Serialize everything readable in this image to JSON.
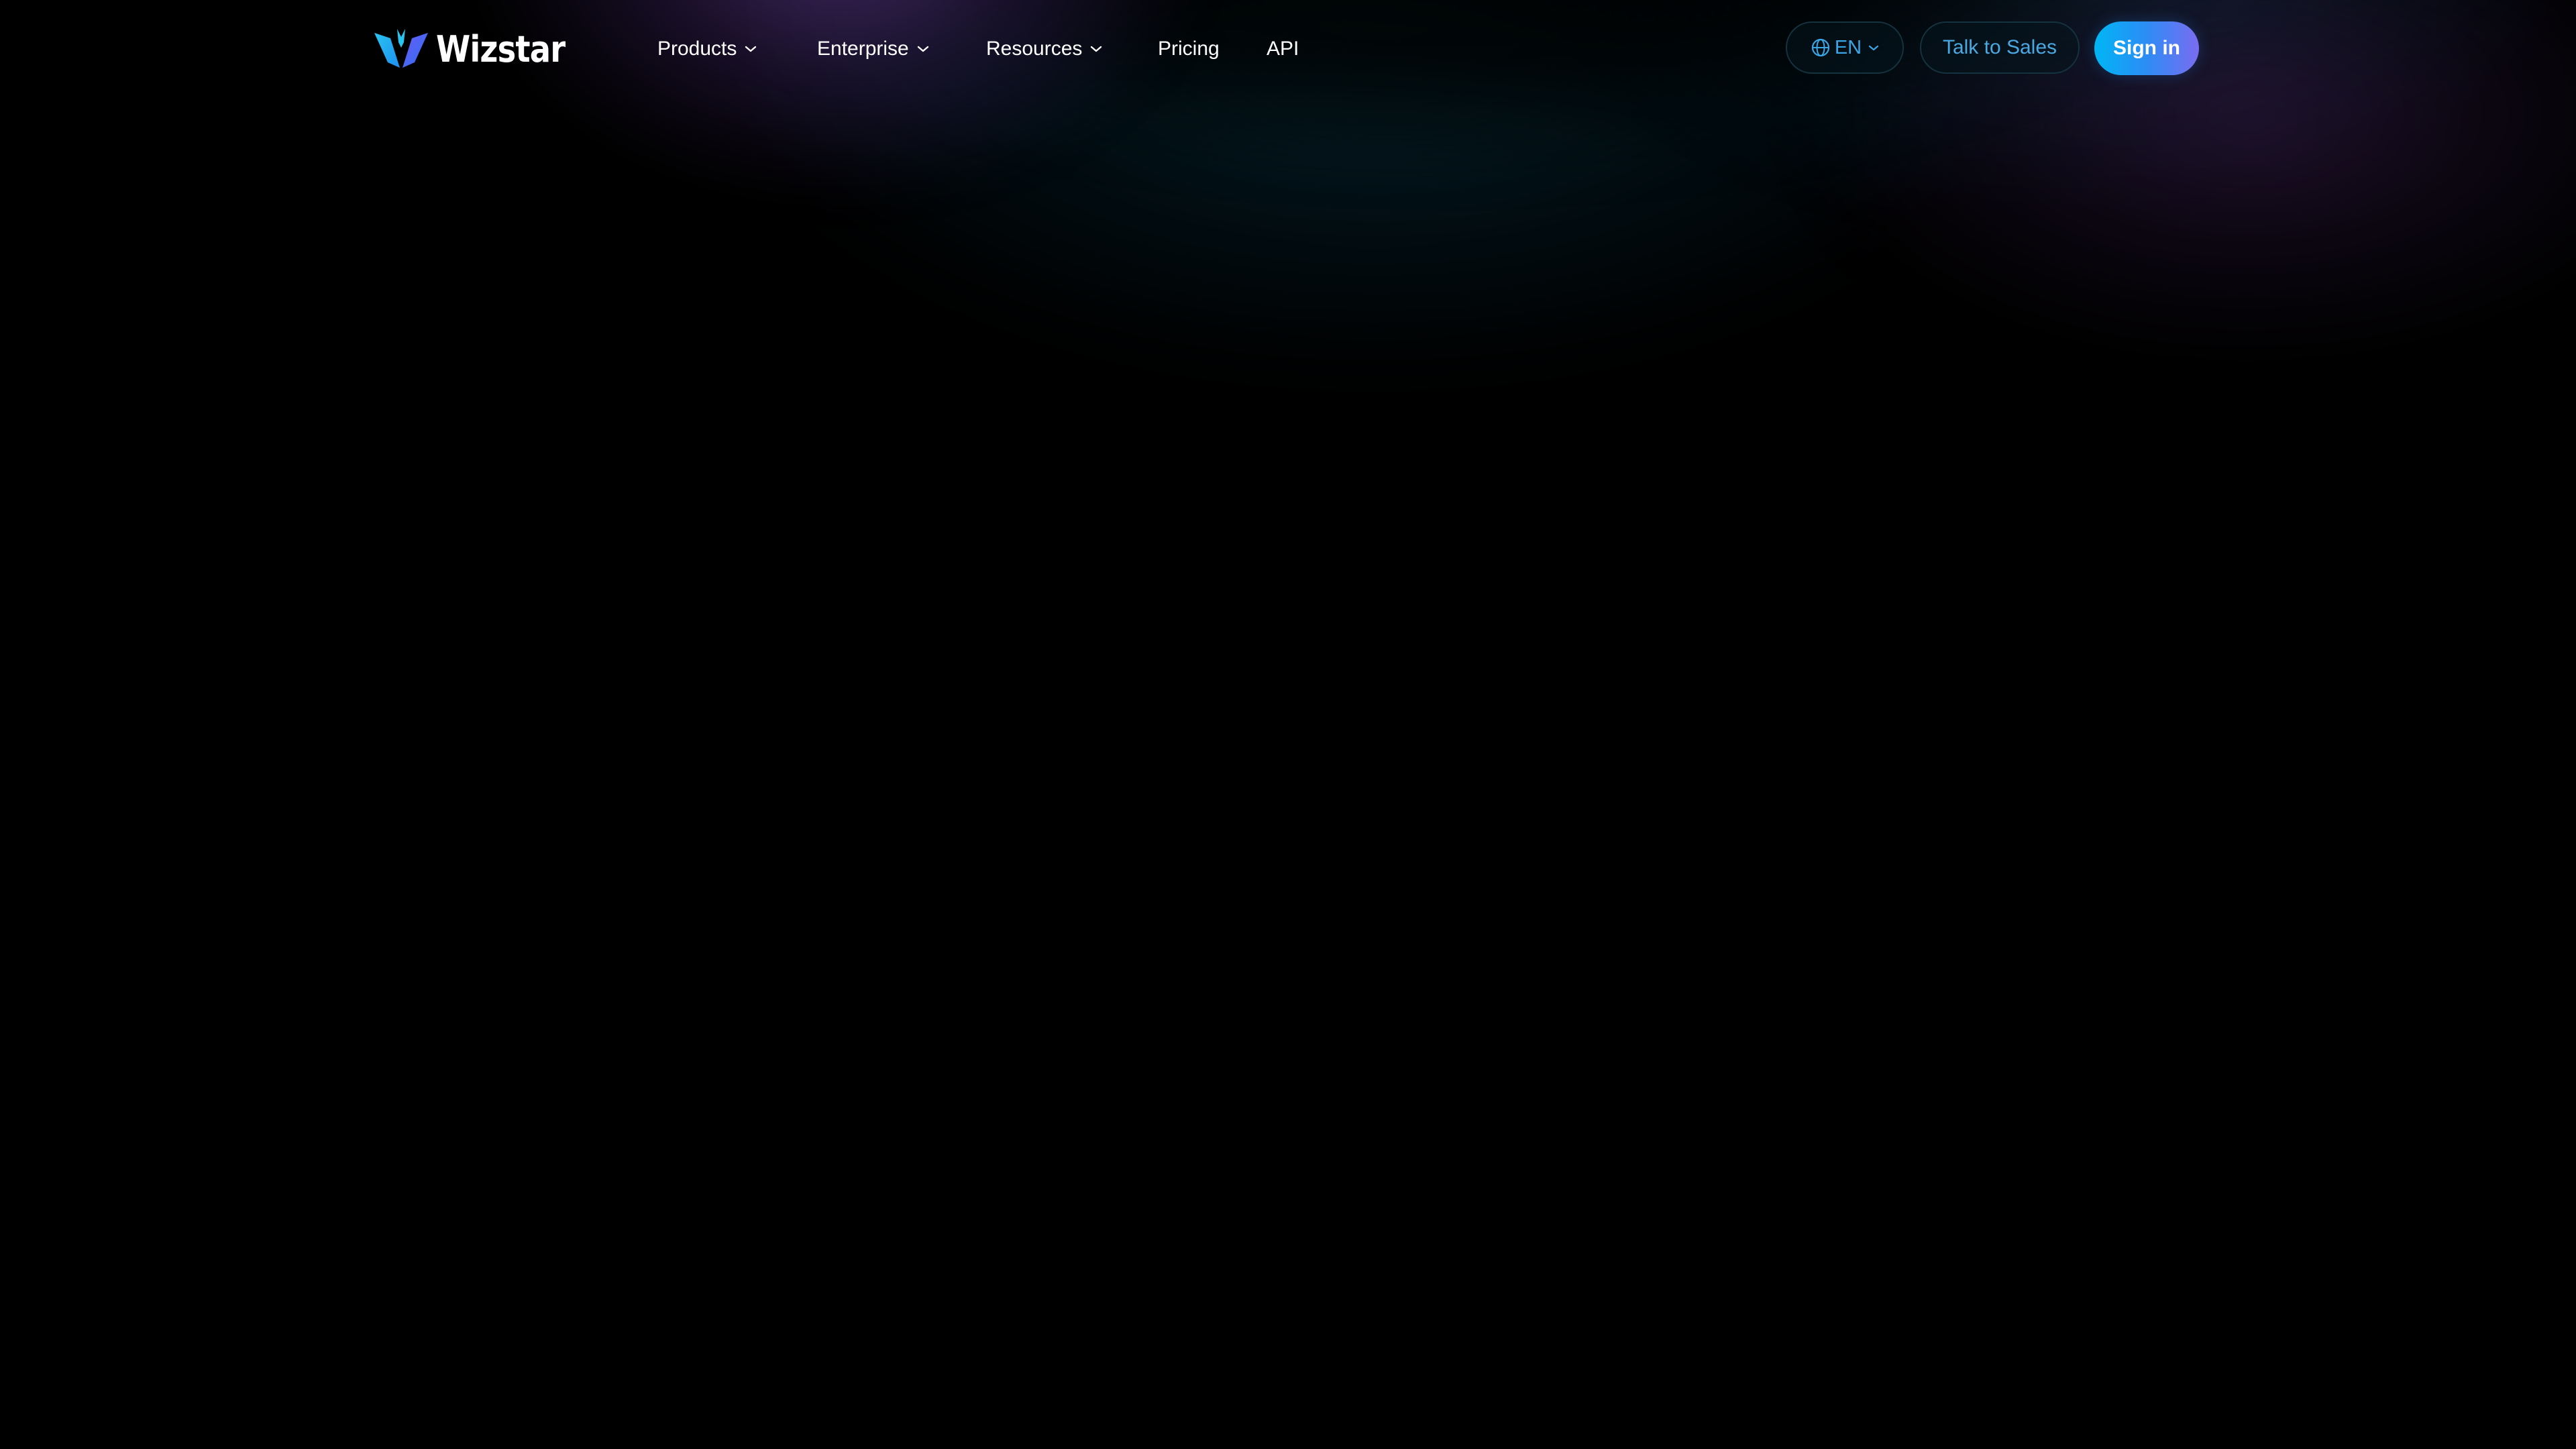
{
  "brand": {
    "name": "Wizstar",
    "logo_icon": "butterfly-logo-icon",
    "logo_colors": [
      "#1e8ff2",
      "#6a5cf5",
      "#29c4f0"
    ]
  },
  "nav": {
    "items": [
      {
        "label": "Products",
        "has_dropdown": true,
        "icon": "chevron-down-icon"
      },
      {
        "label": "Enterprise",
        "has_dropdown": true,
        "icon": "chevron-down-icon"
      },
      {
        "label": "Resources",
        "has_dropdown": true,
        "icon": "chevron-down-icon"
      },
      {
        "label": "Pricing",
        "has_dropdown": false
      },
      {
        "label": "API",
        "has_dropdown": false
      }
    ]
  },
  "actions": {
    "language": {
      "label": "EN",
      "icon": "globe-icon",
      "dropdown_icon": "chevron-down-icon"
    },
    "talk_to_sales": {
      "label": "Talk to Sales"
    },
    "sign_in": {
      "label": "Sign in"
    }
  },
  "colors": {
    "background": "#000000",
    "nav_text": "#ffffff",
    "accent_blue": "#3aa6e6",
    "signin_gradient_start": "#00b6f4",
    "signin_gradient_end": "#7b6cf0",
    "glow_purple": "#7646aa",
    "glow_teal": "#0a3e4e"
  }
}
